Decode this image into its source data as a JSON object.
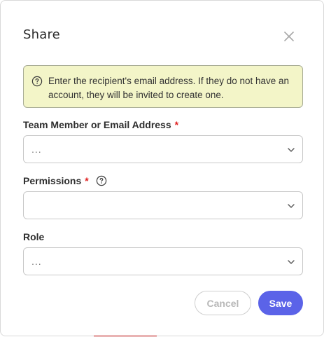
{
  "dialog": {
    "title": "Share",
    "close_icon": "close-icon"
  },
  "info": {
    "icon": "help-circle-icon",
    "text": "Enter the recipient's email address. If they do not have an account, they will be invited to create one."
  },
  "fields": {
    "member": {
      "label": "Team Member or Email Address",
      "required_mark": "*",
      "value": "...",
      "icon": "chevron-down-icon"
    },
    "permissions": {
      "label": "Permissions",
      "required_mark": "*",
      "help_icon": "help-circle-icon",
      "value": "",
      "icon": "chevron-down-icon"
    },
    "role": {
      "label": "Role",
      "value": "...",
      "icon": "chevron-down-icon"
    }
  },
  "actions": {
    "cancel_label": "Cancel",
    "save_label": "Save"
  },
  "colors": {
    "info_bg": "#f3f5c8",
    "accent": "#5b63e8",
    "required": "#e02020"
  }
}
